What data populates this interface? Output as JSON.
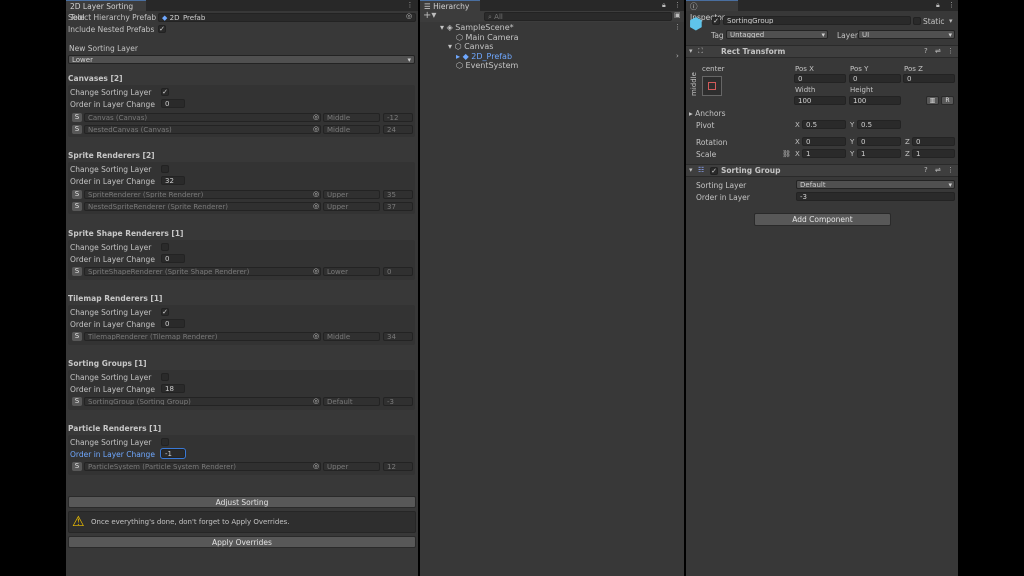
{
  "tool": {
    "tab": "2D Layer Sorting Tool",
    "select_prefab_label": "Select Hierarchy Prefab",
    "select_prefab_value": "2D_Prefab",
    "include_nested_label": "Include Nested Prefabs",
    "new_layer_label": "New Sorting Layer",
    "new_layer_value": "Lower",
    "change_label": "Change Sorting Layer",
    "order_label": "Order in Layer Change",
    "canvases": {
      "title": "Canvases [2]",
      "order": "0",
      "items": [
        {
          "s": "S",
          "name": "Canvas (Canvas)",
          "layer": "Middle",
          "order": "-12"
        },
        {
          "s": "S",
          "name": "NestedCanvas (Canvas)",
          "layer": "Middle",
          "order": "24"
        }
      ]
    },
    "sprite": {
      "title": "Sprite Renderers [2]",
      "order": "32",
      "items": [
        {
          "s": "S",
          "name": "SpriteRenderer (Sprite Renderer)",
          "layer": "Upper",
          "order": "35"
        },
        {
          "s": "S",
          "name": "NestedSpriteRenderer (Sprite Renderer)",
          "layer": "Upper",
          "order": "37"
        }
      ]
    },
    "shape": {
      "title": "Sprite Shape Renderers [1]",
      "order": "0",
      "items": [
        {
          "s": "S",
          "name": "SpriteShapeRenderer (Sprite Shape Renderer)",
          "layer": "Lower",
          "order": "0"
        }
      ]
    },
    "tilemap": {
      "title": "Tilemap Renderers [1]",
      "order": "0",
      "items": [
        {
          "s": "S",
          "name": "TilemapRenderer (Tilemap Renderer)",
          "layer": "Middle",
          "order": "34"
        }
      ]
    },
    "groups": {
      "title": "Sorting Groups [1]",
      "order": "18",
      "items": [
        {
          "s": "S",
          "name": "SortingGroup (Sorting Group)",
          "layer": "Default",
          "order": "-3"
        }
      ]
    },
    "particles": {
      "title": "Particle Renderers [1]",
      "order": "-1",
      "items": [
        {
          "s": "S",
          "name": "ParticleSystem (Particle System Renderer)",
          "layer": "Upper",
          "order": "12"
        }
      ]
    },
    "adjust_button": "Adjust Sorting",
    "warning": "Once everything's done, don't forget to Apply Overrides.",
    "apply_button": "Apply Overrides"
  },
  "hierarchy": {
    "tab": "Hierarchy",
    "add": "+",
    "search_placeholder": "All",
    "scene": "SampleScene*",
    "items": [
      "Main Camera",
      "Canvas",
      "2D_Prefab",
      "EventSystem"
    ]
  },
  "inspector": {
    "tab": "Inspector",
    "object_name": "SortingGroup",
    "static_label": "Static",
    "tag_label": "Tag",
    "tag_value": "Untagged",
    "layer_label": "Layer",
    "layer_value": "UI",
    "rect": {
      "title": "Rect Transform",
      "anchor_top": "center",
      "anchor_side": "middle",
      "posx_label": "Pos X",
      "posy_label": "Pos Y",
      "posz_label": "Pos Z",
      "posx": "0",
      "posy": "0",
      "posz": "0",
      "width_label": "Width",
      "height_label": "Height",
      "width": "100",
      "height": "100",
      "anchors_label": "Anchors",
      "pivot_label": "Pivot",
      "pivot_x": "0.5",
      "pivot_y": "0.5",
      "rotation_label": "Rotation",
      "rot_x": "0",
      "rot_y": "0",
      "rot_z": "0",
      "scale_label": "Scale",
      "scale_x": "1",
      "scale_y": "1",
      "scale_z": "1",
      "x": "X",
      "y": "Y",
      "z": "Z"
    },
    "sorting_group": {
      "title": "Sorting Group",
      "layer_label": "Sorting Layer",
      "layer_value": "Default",
      "order_label": "Order in Layer",
      "order_value": "-3"
    },
    "add_component": "Add Component"
  }
}
